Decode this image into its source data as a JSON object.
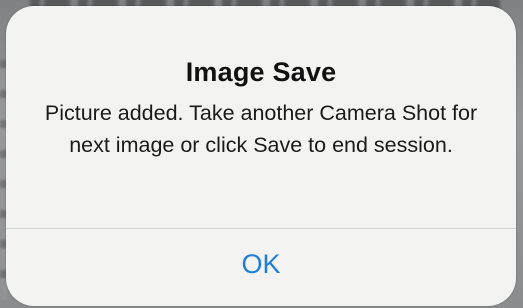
{
  "alert": {
    "title": "Image Save",
    "message": "Picture added. Take another Camera Shot for next image or click Save to end session.",
    "button_label": "OK",
    "button_color": "#1f7ed8"
  }
}
